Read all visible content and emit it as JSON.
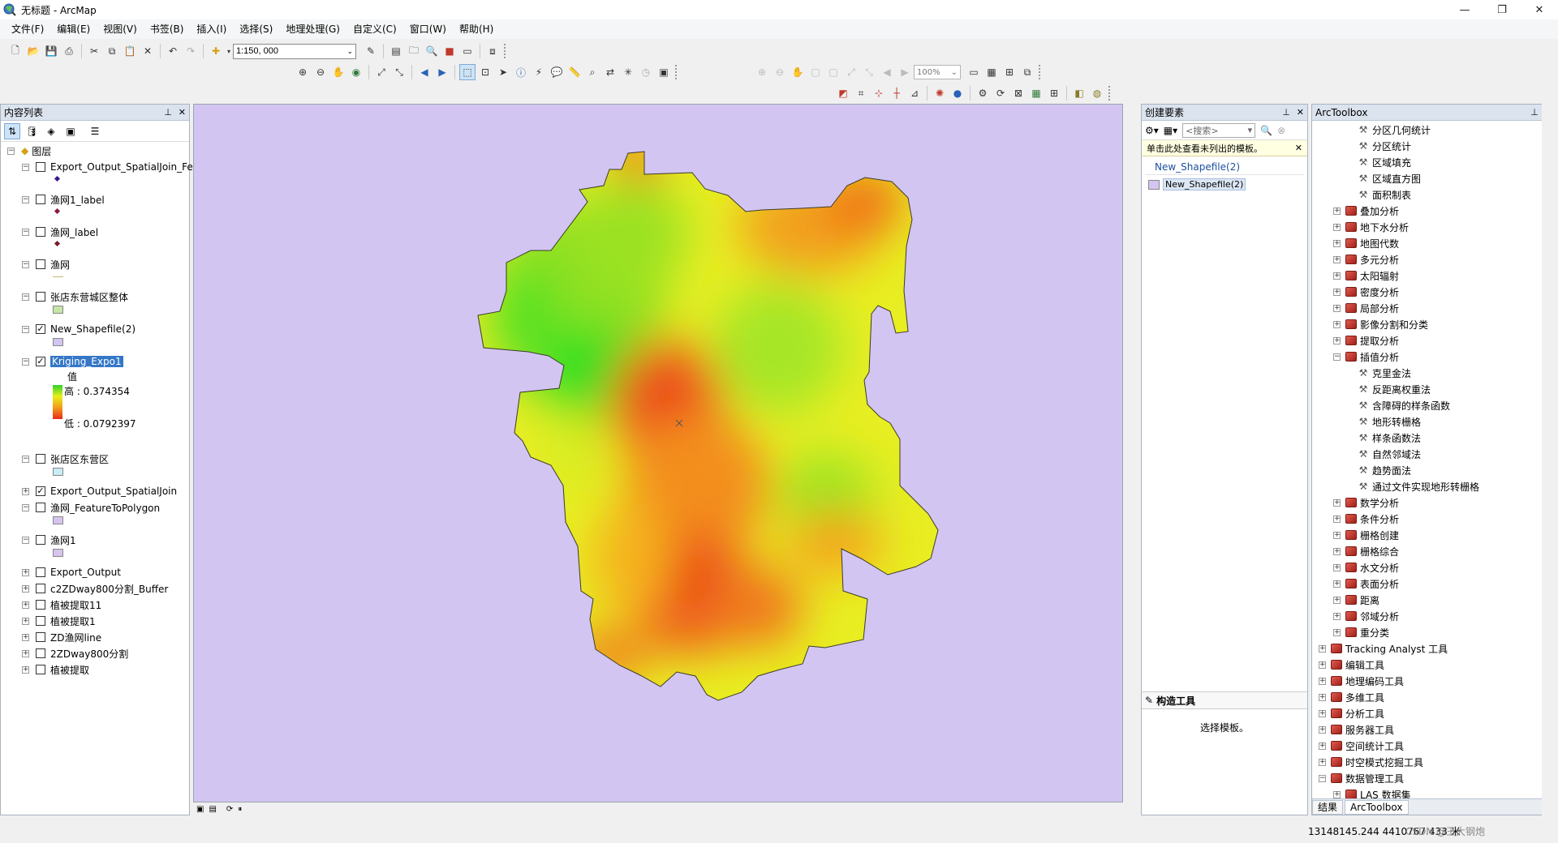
{
  "window": {
    "title": "无标题 - ArcMap",
    "controls": [
      "—",
      "❐",
      "✕"
    ]
  },
  "menu": [
    "文件(F)",
    "编辑(E)",
    "视图(V)",
    "书签(B)",
    "插入(I)",
    "选择(S)",
    "地理处理(G)",
    "自定义(C)",
    "窗口(W)",
    "帮助(H)"
  ],
  "toolbar": {
    "scale": "1:150, 000",
    "zoom_percent": "100%"
  },
  "toc": {
    "title": "内容列表",
    "root_label": "图层",
    "layers": [
      {
        "name": "Export_Output_SpatialJoin_Fe",
        "checked": false,
        "expanded": true,
        "symbol": "point",
        "color": "#3a1a8a"
      },
      {
        "name": "渔网1_label",
        "checked": false,
        "expanded": true,
        "symbol": "point",
        "color": "#8a1a3a"
      },
      {
        "name": "渔网_label",
        "checked": false,
        "expanded": true,
        "symbol": "point",
        "color": "#7a1a2a"
      },
      {
        "name": "渔网",
        "checked": false,
        "expanded": true,
        "symbol": "line",
        "color": "#c9b86e"
      },
      {
        "name": "张店东营城区整体",
        "checked": false,
        "expanded": true,
        "symbol": "fill",
        "color": "#c5e6a8"
      },
      {
        "name": "New_Shapefile(2)",
        "checked": true,
        "expanded": true,
        "symbol": "fill",
        "color": "#d3c5f1"
      },
      {
        "name": "Kriging_Expo1",
        "checked": true,
        "expanded": true,
        "symbol": "ramp",
        "selected": true,
        "legend": {
          "field": "值",
          "high": "高 : 0.374354",
          "low": "低 : 0.0792397"
        }
      },
      {
        "name": "张店区东营区",
        "checked": false,
        "expanded": true,
        "symbol": "fill",
        "color": "#c9ecf6"
      },
      {
        "name": "Export_Output_SpatialJoin",
        "checked": true,
        "expanded": false,
        "symbol": "none"
      },
      {
        "name": "渔网_FeatureToPolygon",
        "checked": false,
        "expanded": true,
        "symbol": "fill",
        "color": "#d6c4ee"
      },
      {
        "name": "渔网1",
        "checked": false,
        "expanded": true,
        "symbol": "fill",
        "color": "#d6c4ee"
      },
      {
        "name": "Export_Output",
        "checked": false,
        "expanded": false,
        "symbol": "none"
      },
      {
        "name": "c2ZDway800分割_Buffer",
        "checked": false,
        "expanded": false,
        "symbol": "none"
      },
      {
        "name": "植被提取11",
        "checked": false,
        "expanded": false,
        "symbol": "none"
      },
      {
        "name": "植被提取1",
        "checked": false,
        "expanded": false,
        "symbol": "none"
      },
      {
        "name": "ZD渔网line",
        "checked": false,
        "expanded": false,
        "symbol": "none"
      },
      {
        "name": "2ZDway800分割",
        "checked": false,
        "expanded": false,
        "symbol": "none"
      },
      {
        "name": "植被提取",
        "checked": false,
        "expanded": false,
        "symbol": "none"
      }
    ]
  },
  "map": {
    "background": "#d3c5f1"
  },
  "create_features": {
    "title": "创建要素",
    "search_placeholder": "<搜索>",
    "banner": "单击此处查看未列出的模板。",
    "group": "New_Shapefile(2)",
    "template": "New_Shapefile(2)",
    "construct_title": "构造工具",
    "construct_hint": "选择模板。"
  },
  "arctoolbox": {
    "title": "ArcToolbox",
    "items": [
      {
        "label": "分区几何统计",
        "level": 2,
        "type": "tool"
      },
      {
        "label": "分区统计",
        "level": 2,
        "type": "tool"
      },
      {
        "label": "区域填充",
        "level": 2,
        "type": "tool"
      },
      {
        "label": "区域直方图",
        "level": 2,
        "type": "tool"
      },
      {
        "label": "面积制表",
        "level": 2,
        "type": "tool"
      },
      {
        "label": "叠加分析",
        "level": 1,
        "type": "toolset"
      },
      {
        "label": "地下水分析",
        "level": 1,
        "type": "toolset"
      },
      {
        "label": "地图代数",
        "level": 1,
        "type": "toolset"
      },
      {
        "label": "多元分析",
        "level": 1,
        "type": "toolset"
      },
      {
        "label": "太阳辐射",
        "level": 1,
        "type": "toolset"
      },
      {
        "label": "密度分析",
        "level": 1,
        "type": "toolset"
      },
      {
        "label": "局部分析",
        "level": 1,
        "type": "toolset"
      },
      {
        "label": "影像分割和分类",
        "level": 1,
        "type": "toolset"
      },
      {
        "label": "提取分析",
        "level": 1,
        "type": "toolset"
      },
      {
        "label": "插值分析",
        "level": 1,
        "type": "toolset",
        "expanded": true
      },
      {
        "label": "克里金法",
        "level": 2,
        "type": "tool"
      },
      {
        "label": "反距离权重法",
        "level": 2,
        "type": "tool"
      },
      {
        "label": "含障碍的样条函数",
        "level": 2,
        "type": "tool"
      },
      {
        "label": "地形转栅格",
        "level": 2,
        "type": "tool"
      },
      {
        "label": "样条函数法",
        "level": 2,
        "type": "tool"
      },
      {
        "label": "自然邻域法",
        "level": 2,
        "type": "tool"
      },
      {
        "label": "趋势面法",
        "level": 2,
        "type": "tool"
      },
      {
        "label": "通过文件实现地形转栅格",
        "level": 2,
        "type": "tool"
      },
      {
        "label": "数学分析",
        "level": 1,
        "type": "toolset"
      },
      {
        "label": "条件分析",
        "level": 1,
        "type": "toolset"
      },
      {
        "label": "栅格创建",
        "level": 1,
        "type": "toolset"
      },
      {
        "label": "栅格综合",
        "level": 1,
        "type": "toolset"
      },
      {
        "label": "水文分析",
        "level": 1,
        "type": "toolset"
      },
      {
        "label": "表面分析",
        "level": 1,
        "type": "toolset"
      },
      {
        "label": "距离",
        "level": 1,
        "type": "toolset"
      },
      {
        "label": "邻域分析",
        "level": 1,
        "type": "toolset"
      },
      {
        "label": "重分类",
        "level": 1,
        "type": "toolset"
      },
      {
        "label": "Tracking Analyst 工具",
        "level": 0,
        "type": "toolbox"
      },
      {
        "label": "编辑工具",
        "level": 0,
        "type": "toolbox"
      },
      {
        "label": "地理编码工具",
        "level": 0,
        "type": "toolbox"
      },
      {
        "label": "多维工具",
        "level": 0,
        "type": "toolbox"
      },
      {
        "label": "分析工具",
        "level": 0,
        "type": "toolbox"
      },
      {
        "label": "服务器工具",
        "level": 0,
        "type": "toolbox"
      },
      {
        "label": "空间统计工具",
        "level": 0,
        "type": "toolbox"
      },
      {
        "label": "时空模式挖掘工具",
        "level": 0,
        "type": "toolbox"
      },
      {
        "label": "数据管理工具",
        "level": 0,
        "type": "toolbox",
        "expanded": true
      },
      {
        "label": "LAS 数据集",
        "level": 1,
        "type": "toolset"
      }
    ],
    "tabs": [
      "结果",
      "ArcToolbox"
    ]
  },
  "status": {
    "coordinates": "13148145.244  4410767.433 米",
    "watermark": "CSDN @王大钢炮"
  }
}
